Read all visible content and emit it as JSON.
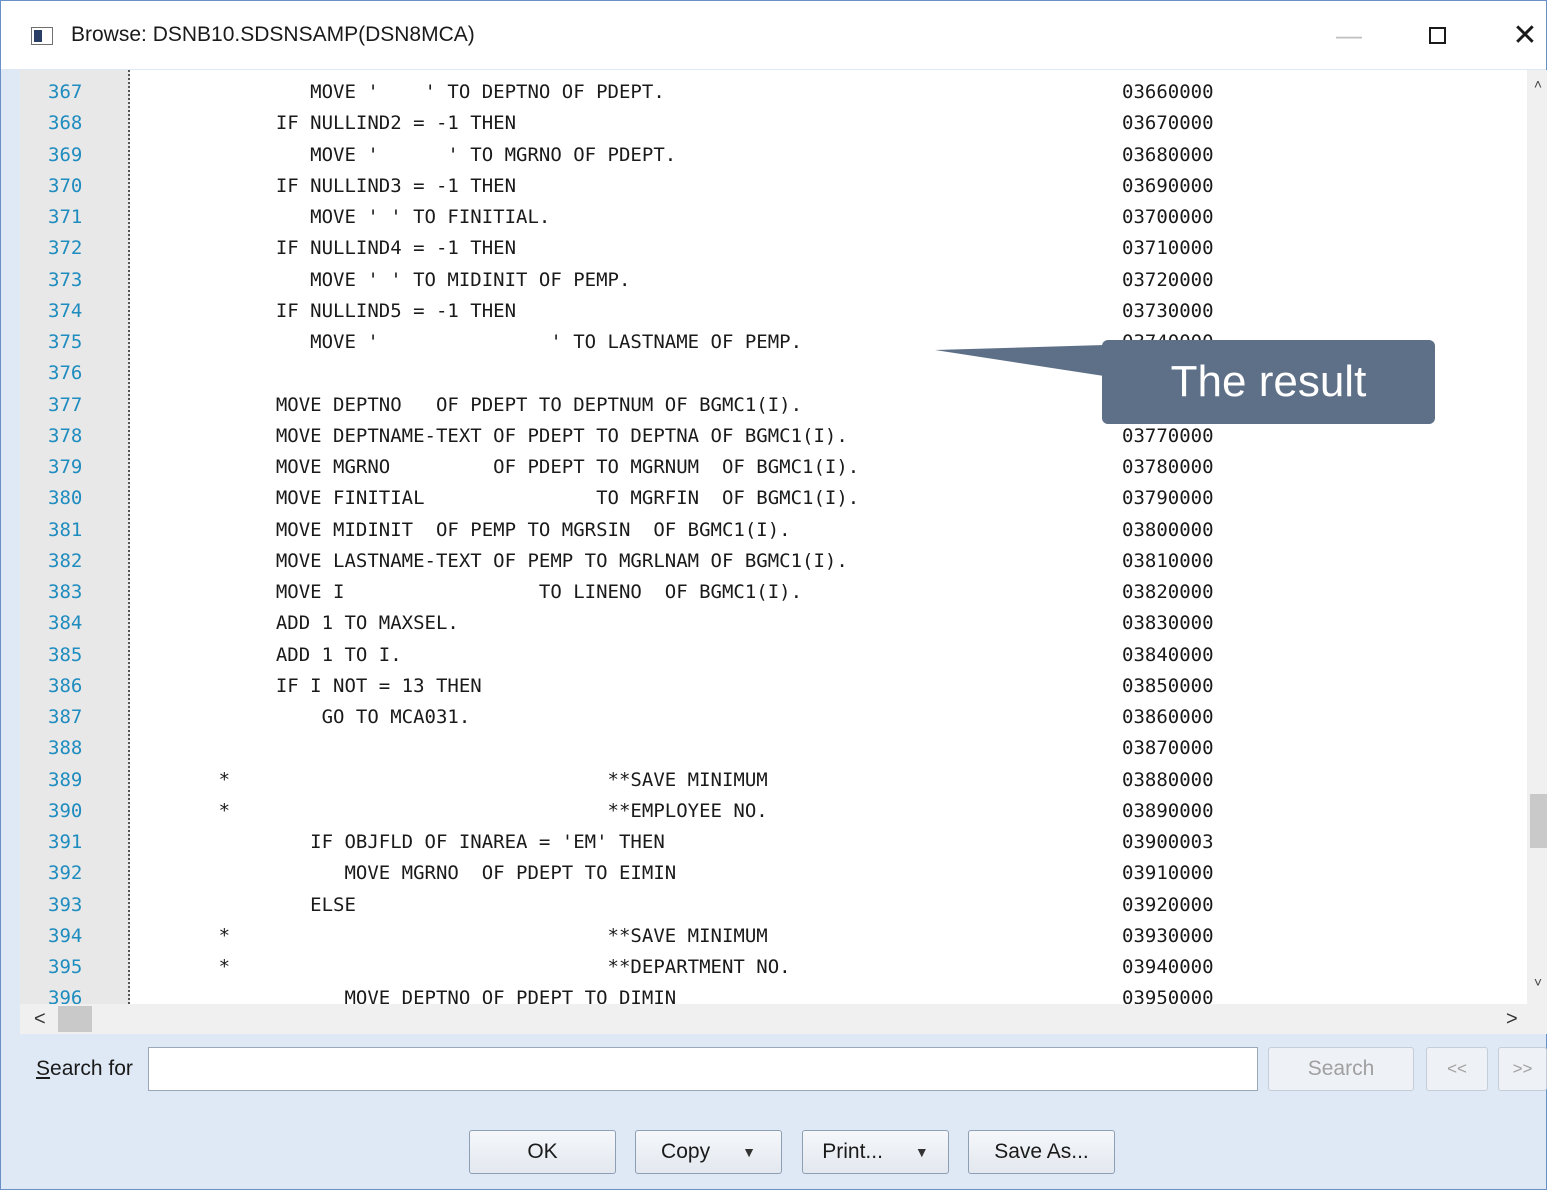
{
  "window": {
    "title": "Browse: DSNB10.SDSNSAMP(DSN8MCA)",
    "minimize_glyph": "—",
    "close_glyph": "✕"
  },
  "lines": [
    {
      "num": "367",
      "code": "              MOVE '    ' TO DEPTNO OF PDEPT.",
      "seq": "03660000"
    },
    {
      "num": "368",
      "code": "           IF NULLIND2 = -1 THEN",
      "seq": "03670000"
    },
    {
      "num": "369",
      "code": "              MOVE '      ' TO MGRNO OF PDEPT.",
      "seq": "03680000"
    },
    {
      "num": "370",
      "code": "           IF NULLIND3 = -1 THEN",
      "seq": "03690000"
    },
    {
      "num": "371",
      "code": "              MOVE ' ' TO FINITIAL.",
      "seq": "03700000"
    },
    {
      "num": "372",
      "code": "           IF NULLIND4 = -1 THEN",
      "seq": "03710000"
    },
    {
      "num": "373",
      "code": "              MOVE ' ' TO MIDINIT OF PEMP.",
      "seq": "03720000"
    },
    {
      "num": "374",
      "code": "           IF NULLIND5 = -1 THEN",
      "seq": "03730000"
    },
    {
      "num": "375",
      "code": "              MOVE '               ' TO LASTNAME OF PEMP.",
      "seq": "03740000"
    },
    {
      "num": "376",
      "code": "",
      "seq": ""
    },
    {
      "num": "377",
      "code": "           MOVE DEPTNO   OF PDEPT TO DEPTNUM OF BGMC1(I).",
      "seq": ""
    },
    {
      "num": "378",
      "code": "           MOVE DEPTNAME-TEXT OF PDEPT TO DEPTNA OF BGMC1(I).",
      "seq": "03770000"
    },
    {
      "num": "379",
      "code": "           MOVE MGRNO         OF PDEPT TO MGRNUM  OF BGMC1(I).",
      "seq": "03780000"
    },
    {
      "num": "380",
      "code": "           MOVE FINITIAL               TO MGRFIN  OF BGMC1(I).",
      "seq": "03790000"
    },
    {
      "num": "381",
      "code": "           MOVE MIDINIT  OF PEMP TO MGRSIN  OF BGMC1(I).",
      "seq": "03800000"
    },
    {
      "num": "382",
      "code": "           MOVE LASTNAME-TEXT OF PEMP TO MGRLNAM OF BGMC1(I).",
      "seq": "03810000"
    },
    {
      "num": "383",
      "code": "           MOVE I                 TO LINENO  OF BGMC1(I).",
      "seq": "03820000"
    },
    {
      "num": "384",
      "code": "           ADD 1 TO MAXSEL.",
      "seq": "03830000"
    },
    {
      "num": "385",
      "code": "           ADD 1 TO I.",
      "seq": "03840000"
    },
    {
      "num": "386",
      "code": "           IF I NOT = 13 THEN",
      "seq": "03850000"
    },
    {
      "num": "387",
      "code": "               GO TO MCA031.",
      "seq": "03860000"
    },
    {
      "num": "388",
      "code": "",
      "seq": "03870000"
    },
    {
      "num": "389",
      "code": "      *                                 **SAVE MINIMUM",
      "seq": "03880000"
    },
    {
      "num": "390",
      "code": "      *                                 **EMPLOYEE NO.",
      "seq": "03890000"
    },
    {
      "num": "391",
      "code": "              IF OBJFLD OF INAREA = 'EM' THEN",
      "seq": "03900003"
    },
    {
      "num": "392",
      "code": "                 MOVE MGRNO  OF PDEPT TO EIMIN",
      "seq": "03910000"
    },
    {
      "num": "393",
      "code": "              ELSE",
      "seq": "03920000"
    },
    {
      "num": "394",
      "code": "      *                                 **SAVE MINIMUM",
      "seq": "03930000"
    },
    {
      "num": "395",
      "code": "      *                                 **DEPARTMENT NO.",
      "seq": "03940000"
    },
    {
      "num": "396",
      "code": "                 MOVE DEPTNO OF PDEPT TO DIMIN",
      "seq": "03950000"
    }
  ],
  "callout": {
    "text": "The result"
  },
  "search": {
    "label_accel": "S",
    "label_rest": "earch for",
    "value": "",
    "placeholder": ""
  },
  "buttons": {
    "search": "Search",
    "prev": "<<",
    "next": ">>",
    "ok": "OK",
    "copy": "Copy",
    "print": "Print...",
    "save_as": "Save As..."
  },
  "icons": {
    "app": "window-app-icon",
    "dropdown": "▼",
    "scroll_up": "˄",
    "scroll_down": "˅",
    "scroll_left": "<",
    "scroll_right": ">"
  }
}
